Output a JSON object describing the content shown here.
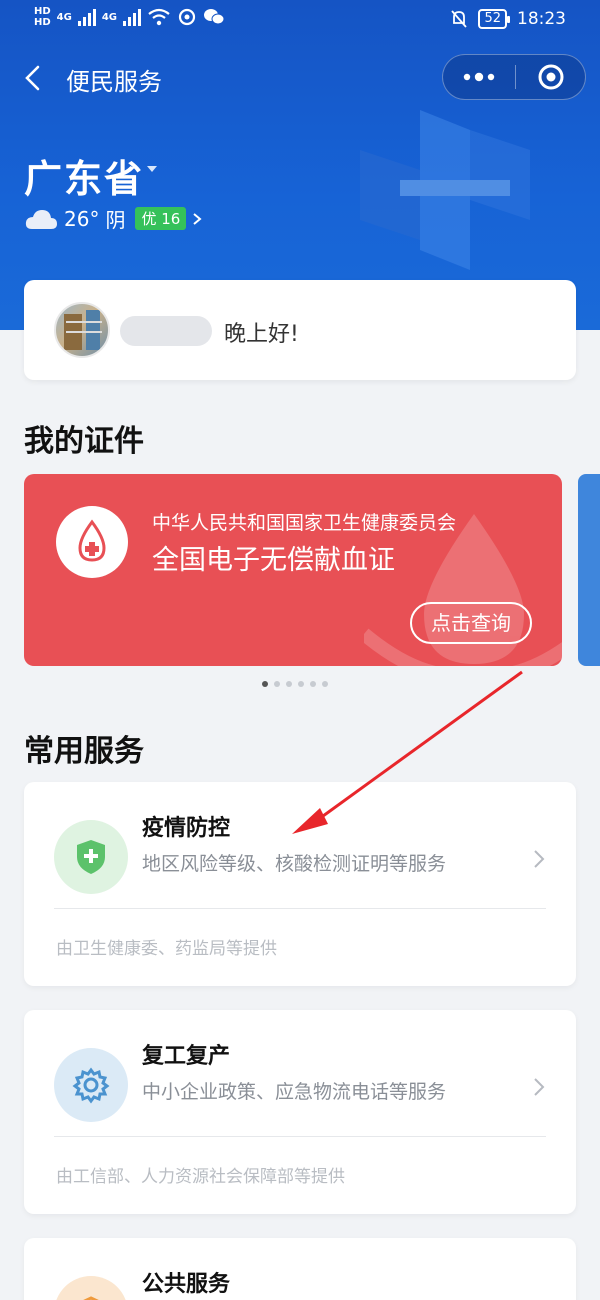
{
  "status_bar": {
    "hd1": "HD",
    "hd2": "HD",
    "net1": "4G",
    "net2": "4G",
    "battery": "52",
    "time": "18:23"
  },
  "navbar": {
    "title": "便民服务",
    "icons": [
      "back-icon",
      "more-icon",
      "close-target-icon"
    ]
  },
  "location": {
    "province": "广东省",
    "weather": {
      "temp": "26°",
      "condition": "阴",
      "aqi": "优 16",
      "aqi_color": "#35c15a"
    }
  },
  "greeting_card": {
    "greeting": "晚上好!"
  },
  "my_credentials": {
    "section_title": "我的证件",
    "card": {
      "org": "中华人民共和国国家卫生健康委员会",
      "title": "全国电子无偿献血证",
      "button": "点击查询",
      "color": "#e85055"
    },
    "pager": {
      "count": 6,
      "active": 0
    }
  },
  "common_services": {
    "section_title": "常用服务",
    "items": [
      {
        "title": "疫情防控",
        "desc": "地区风险等级、核酸检测证明等服务",
        "provider": "由卫生健康委、药监局等提供",
        "icon": "shield-plus-icon",
        "icon_bg": "#dff3e1"
      },
      {
        "title": "复工复产",
        "desc": "中小企业政策、应急物流电话等服务",
        "provider": "由工信部、人力资源社会保障部等提供",
        "icon": "gear-icon",
        "icon_bg": "#dbeaf6"
      },
      {
        "title": "公共服务",
        "icon": "box-icon",
        "icon_bg": "#fbe6cf"
      }
    ]
  },
  "annotation": {
    "arrow_color": "#e8262b"
  }
}
